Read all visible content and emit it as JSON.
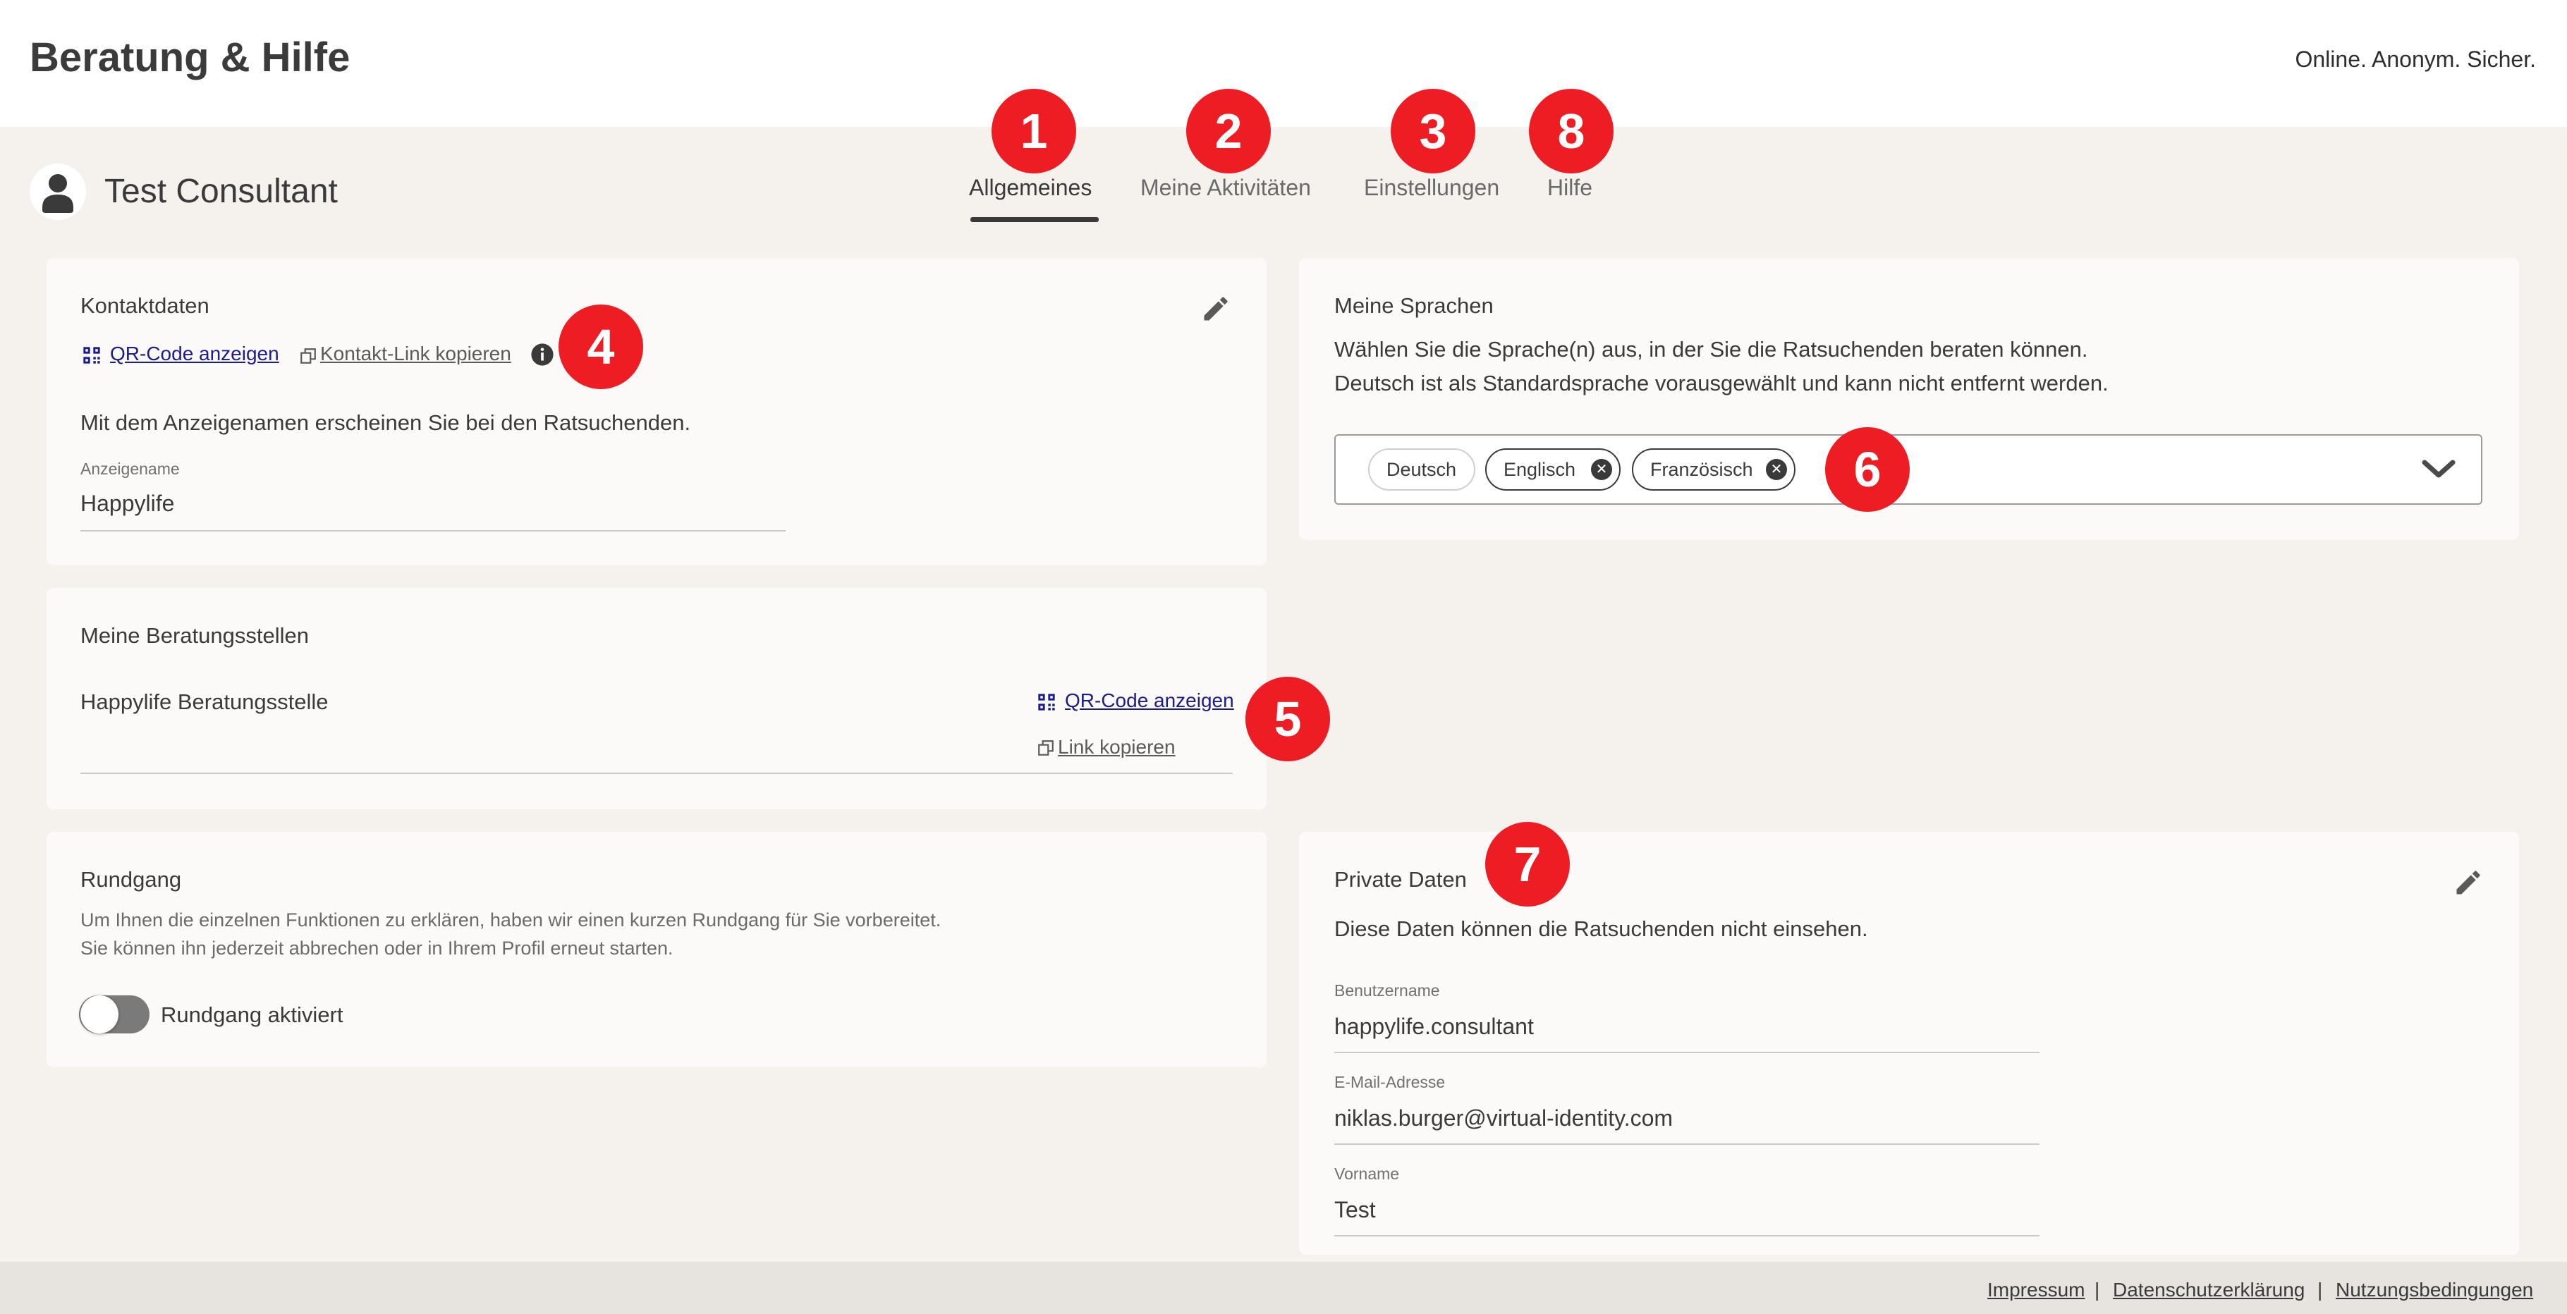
{
  "header": {
    "brand": "Beratung & Hilfe",
    "tagline": "Online. Anonym. Sicher."
  },
  "profile": {
    "name": "Test Consultant"
  },
  "tabs": [
    {
      "label": "Allgemeines",
      "active": true
    },
    {
      "label": "Meine Aktivitäten",
      "active": false
    },
    {
      "label": "Einstellungen",
      "active": false
    },
    {
      "label": "Hilfe",
      "active": false
    }
  ],
  "markers": [
    "1",
    "2",
    "3",
    "8",
    "4",
    "5",
    "6",
    "7"
  ],
  "contact": {
    "title": "Kontaktdaten",
    "qr_link": "QR-Code anzeigen",
    "copy_link": "Kontakt-Link kopieren",
    "description": "Mit dem Anzeigenamen erscheinen Sie bei den Ratsuchenden.",
    "display_name_label": "Anzeigename",
    "display_name_value": "Happylife"
  },
  "offices": {
    "title": "Meine Beratungsstellen",
    "office_name": "Happylife Beratungsstelle",
    "qr_link": "QR-Code anzeigen",
    "copy_link": "Link kopieren"
  },
  "tour": {
    "title": "Rundgang",
    "text_line1": "Um Ihnen die einzelnen Funktionen zu erklären, haben wir einen kurzen Rundgang für Sie vorbereitet.",
    "text_line2": "Sie können ihn jederzeit abbrechen oder in Ihrem Profil erneut starten.",
    "toggle_label": "Rundgang aktiviert"
  },
  "languages": {
    "title": "Meine Sprachen",
    "text_line1": "Wählen Sie die Sprache(n) aus, in der Sie die Ratsuchenden beraten können.",
    "text_line2": "Deutsch ist als Standardsprache vorausgewählt und kann nicht entfernt werden.",
    "chips": [
      "Deutsch",
      "Englisch",
      "Französisch"
    ]
  },
  "private": {
    "title": "Private Daten",
    "description": "Diese Daten können die Ratsuchenden nicht einsehen.",
    "username_label": "Benutzername",
    "username_value": "happylife.consultant",
    "email_label": "E-Mail-Adresse",
    "email_value": "niklas.burger@virtual-identity.com",
    "firstname_label": "Vorname",
    "firstname_value": "Test"
  },
  "footer": {
    "links": [
      "Impressum",
      "Datenschutzerklärung",
      "Nutzungsbedingungen"
    ],
    "separator": "|"
  },
  "colors": {
    "marker": "#ee1d23",
    "link": "#1c1c8a",
    "background": "#f5f2ee",
    "card": "#fbfaf8"
  }
}
